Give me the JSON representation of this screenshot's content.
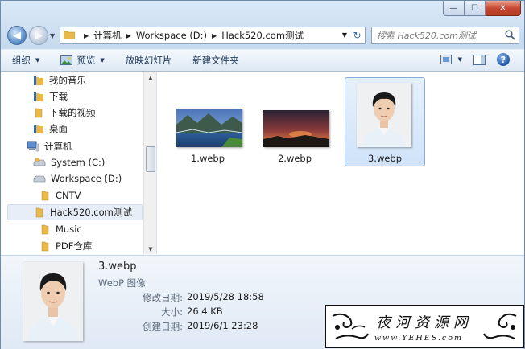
{
  "window": {
    "caption_buttons": {
      "min": "—",
      "max": "☐",
      "close": "✕"
    }
  },
  "navigation": {
    "back_glyph": "◀",
    "forward_glyph": "▶",
    "dropdown_glyph": "▼"
  },
  "address_bar": {
    "segments": [
      "计算机",
      "Workspace (D:)",
      "Hack520.com测试"
    ],
    "separator": "▶",
    "refresh_glyph": "↻"
  },
  "search": {
    "placeholder": "搜索 Hack520.com测试"
  },
  "toolbar": {
    "organize": "组织",
    "preview": "预览",
    "slideshow": "放映幻灯片",
    "new_folder": "新建文件夹",
    "help": "?"
  },
  "nav_tree": [
    {
      "label": "我的音乐",
      "icon": "music-library-icon"
    },
    {
      "label": "下载",
      "icon": "download-folder-icon"
    },
    {
      "label": "下载的视频",
      "icon": "folder-icon"
    },
    {
      "label": "桌面",
      "icon": "desktop-folder-icon"
    },
    {
      "label": "计算机",
      "icon": "computer-icon"
    },
    {
      "label": "System (C:)",
      "icon": "system-drive-icon"
    },
    {
      "label": "Workspace (D:)",
      "icon": "drive-icon"
    },
    {
      "label": "CNTV",
      "icon": "folder-icon"
    },
    {
      "label": "Hack520.com测试",
      "icon": "folder-icon",
      "selected": true
    },
    {
      "label": "Music",
      "icon": "folder-icon"
    },
    {
      "label": "PDF仓库",
      "icon": "folder-icon"
    }
  ],
  "files": [
    {
      "name": "1.webp",
      "thumbnail": "lake-landscape-thumbnail"
    },
    {
      "name": "2.webp",
      "thumbnail": "sunset-sky-thumbnail"
    },
    {
      "name": "3.webp",
      "thumbnail": "portrait-photo-thumbnail",
      "selected": true
    }
  ],
  "details": {
    "name": "3.webp",
    "type": "WebP 图像",
    "modified_label": "修改日期:",
    "modified_value": "2019/5/28 18:58",
    "size_label": "大小:",
    "size_value": "26.4 KB",
    "created_label": "创建日期:",
    "created_value": "2019/6/1 23:28"
  },
  "watermark": {
    "title": "夜河资源网",
    "url": "www.YEHES.com"
  },
  "colors": {
    "title_bar": "#c5d9ee",
    "selection": "#cfe3f9",
    "selection_border": "#84acdd",
    "close_button": "#c74a35",
    "folder": "#e8b84a"
  }
}
